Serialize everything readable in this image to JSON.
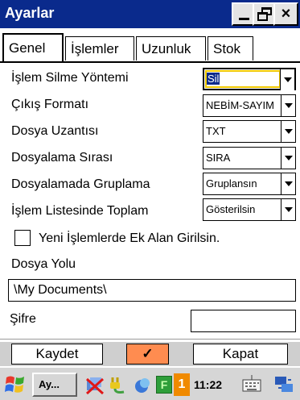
{
  "window": {
    "title": "Ayarlar"
  },
  "titlebar_buttons": {
    "close_glyph": "×"
  },
  "tabs": [
    {
      "label": "Genel",
      "active": true
    },
    {
      "label": "İşlemler",
      "active": false
    },
    {
      "label": "Uzunluk",
      "active": false
    },
    {
      "label": "Stok",
      "active": false
    }
  ],
  "settings": [
    {
      "label": "İşlem Silme Yöntemi",
      "value": "Sil",
      "focused": true
    },
    {
      "label": "Çıkış Formatı",
      "value": "NEBİM-SAYIM"
    },
    {
      "label": "Dosya Uzantısı",
      "value": "TXT"
    },
    {
      "label": "Dosyalama Sırası",
      "value": "SIRA"
    },
    {
      "label": "Dosyalamada Gruplama",
      "value": "Gruplansın"
    },
    {
      "label": "İşlem Listesinde Toplam",
      "value": "Gösterilsin"
    }
  ],
  "extra_fields_checkbox": {
    "label": "Yeni İşlemlerde Ek Alan Girilsin.",
    "checked": false
  },
  "file_path": {
    "label": "Dosya Yolu",
    "value": "\\My Documents\\"
  },
  "password": {
    "label": "Şifre",
    "value": ""
  },
  "buttons": {
    "save": "Kaydet",
    "ok_glyph": "✓",
    "close": "Kapat"
  },
  "taskbar": {
    "app_label": "Ay...",
    "notification_count": "1",
    "time": "11:22",
    "letter_badge": "F"
  },
  "colors": {
    "titlebar": "#0a2a8c",
    "ok_button": "#ff8c50",
    "taskbar": "#d6d6d6"
  }
}
